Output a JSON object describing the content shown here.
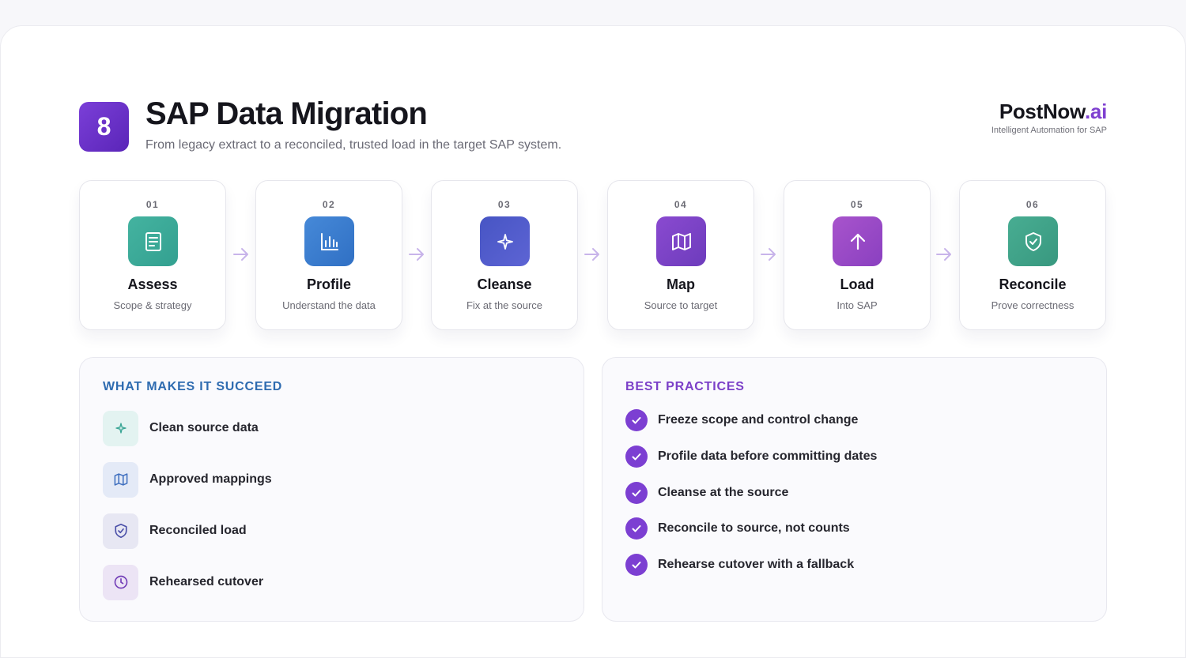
{
  "header": {
    "badge": "8",
    "title": "SAP Data Migration",
    "subtitle": "From legacy extract to a reconciled, trusted load in the target SAP system.",
    "brand_name": "PostNow",
    "brand_suffix": ".ai",
    "brand_tagline": "Intelligent Automation for SAP"
  },
  "steps": [
    {
      "num": "01",
      "title": "Assess",
      "sub": "Scope & strategy",
      "icon": "document-icon",
      "color": "#3aaa98"
    },
    {
      "num": "02",
      "title": "Profile",
      "sub": "Understand the data",
      "icon": "bar-chart-icon",
      "color": "#3a7dd0"
    },
    {
      "num": "03",
      "title": "Cleanse",
      "sub": "Fix at the source",
      "icon": "sparkle-icon",
      "color": "#4a55c8"
    },
    {
      "num": "04",
      "title": "Map",
      "sub": "Source to target",
      "icon": "map-icon",
      "color": "#7a45c8"
    },
    {
      "num": "05",
      "title": "Load",
      "sub": "Into SAP",
      "icon": "arrow-up-icon",
      "color": "#a04cc8"
    },
    {
      "num": "06",
      "title": "Reconcile",
      "sub": "Prove correctness",
      "icon": "shield-check-icon",
      "color": "#3ea38a"
    }
  ],
  "succeed": {
    "heading": "WHAT MAKES IT SUCCEED",
    "items": [
      {
        "label": "Clean source data",
        "icon": "sparkle-icon",
        "bg": "#e3f3f1",
        "fg": "#3aa595"
      },
      {
        "label": "Approved mappings",
        "icon": "map-icon",
        "bg": "#e4eaf7",
        "fg": "#3f6fbf"
      },
      {
        "label": "Reconciled load",
        "icon": "shield-check-icon",
        "bg": "#e7e7f3",
        "fg": "#4a4fa8"
      },
      {
        "label": "Rehearsed cutover",
        "icon": "clock-icon",
        "bg": "#ece4f5",
        "fg": "#7440b8"
      }
    ]
  },
  "practices": {
    "heading": "BEST PRACTICES",
    "items": [
      "Freeze scope and control change",
      "Profile data before committing dates",
      "Cleanse at the source",
      "Reconcile to source, not counts",
      "Rehearse cutover with a fallback"
    ]
  }
}
